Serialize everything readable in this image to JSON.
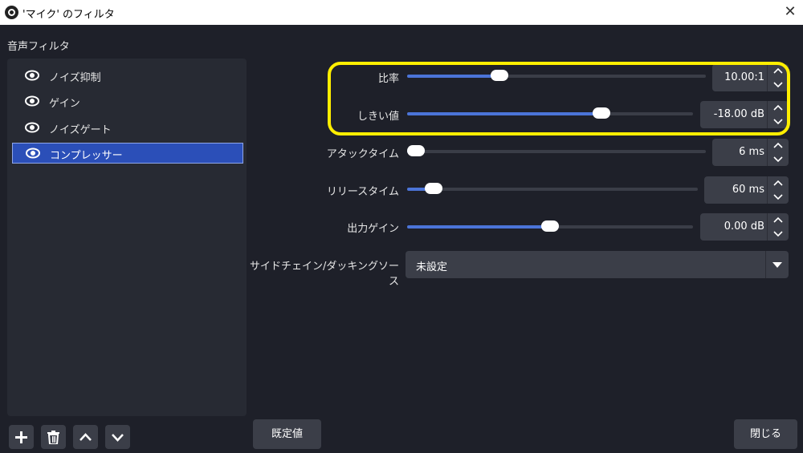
{
  "window": {
    "title": "'マイク' のフィルタ"
  },
  "filters_panel": {
    "section_label": "音声フィルタ",
    "items": [
      {
        "label": "ノイズ抑制",
        "selected": false
      },
      {
        "label": "ゲイン",
        "selected": false
      },
      {
        "label": "ノイズゲート",
        "selected": false
      },
      {
        "label": "コンプレッサー",
        "selected": true
      }
    ]
  },
  "settings": {
    "ratio": {
      "label": "比率",
      "value": "10.00:1",
      "level": 0.31
    },
    "threshold": {
      "label": "しきい値",
      "value": "-18.00 dB",
      "level": 0.68
    },
    "attack": {
      "label": "アタックタイム",
      "value": "6 ms",
      "level": 0.03
    },
    "release": {
      "label": "リリースタイム",
      "value": "60 ms",
      "level": 0.09
    },
    "output_gain": {
      "label": "出力ゲイン",
      "value": "0.00 dB",
      "level": 0.5
    },
    "sidechain": {
      "label": "サイドチェイン/ダッキングソース",
      "value": "未設定"
    }
  },
  "buttons": {
    "defaults": "既定値",
    "close": "閉じる"
  },
  "colors": {
    "accent": "#4b74d8",
    "selection": "#2b4fb8",
    "highlight": "#ffee00",
    "background": "#1e2029"
  }
}
